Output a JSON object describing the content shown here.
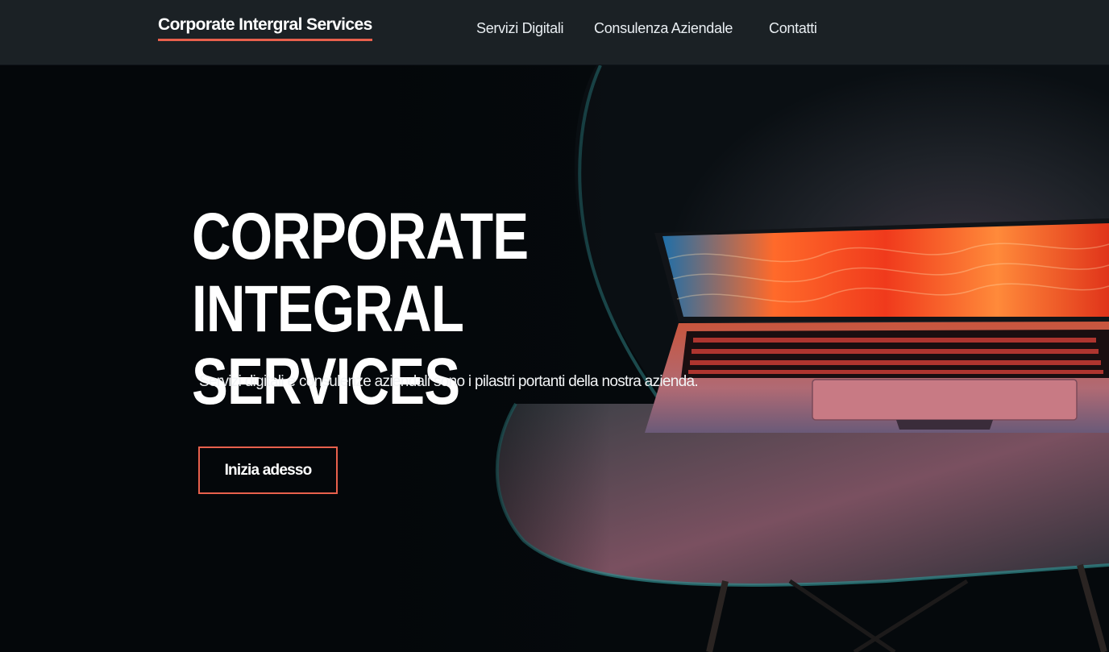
{
  "header": {
    "brand": "Corporate Intergral Services",
    "nav": [
      {
        "label": "Servizi Digitali"
      },
      {
        "label": "Consulenza Aziendale"
      },
      {
        "label": "Contatti"
      }
    ]
  },
  "hero": {
    "title_line1": "CORPORATE INTEGRAL",
    "title_line2": "SERVICES",
    "subtitle": "Servizi digitali e consulenze aziendali sono i pilastri portanti della nostra azienda.",
    "cta_label": "Inizia adesso",
    "background_image": "laptop-on-chair-photo"
  },
  "colors": {
    "accent": "#e8604c",
    "navbar_bg": "#1b2125",
    "hero_bg": "#04070a",
    "text": "#ffffff"
  }
}
